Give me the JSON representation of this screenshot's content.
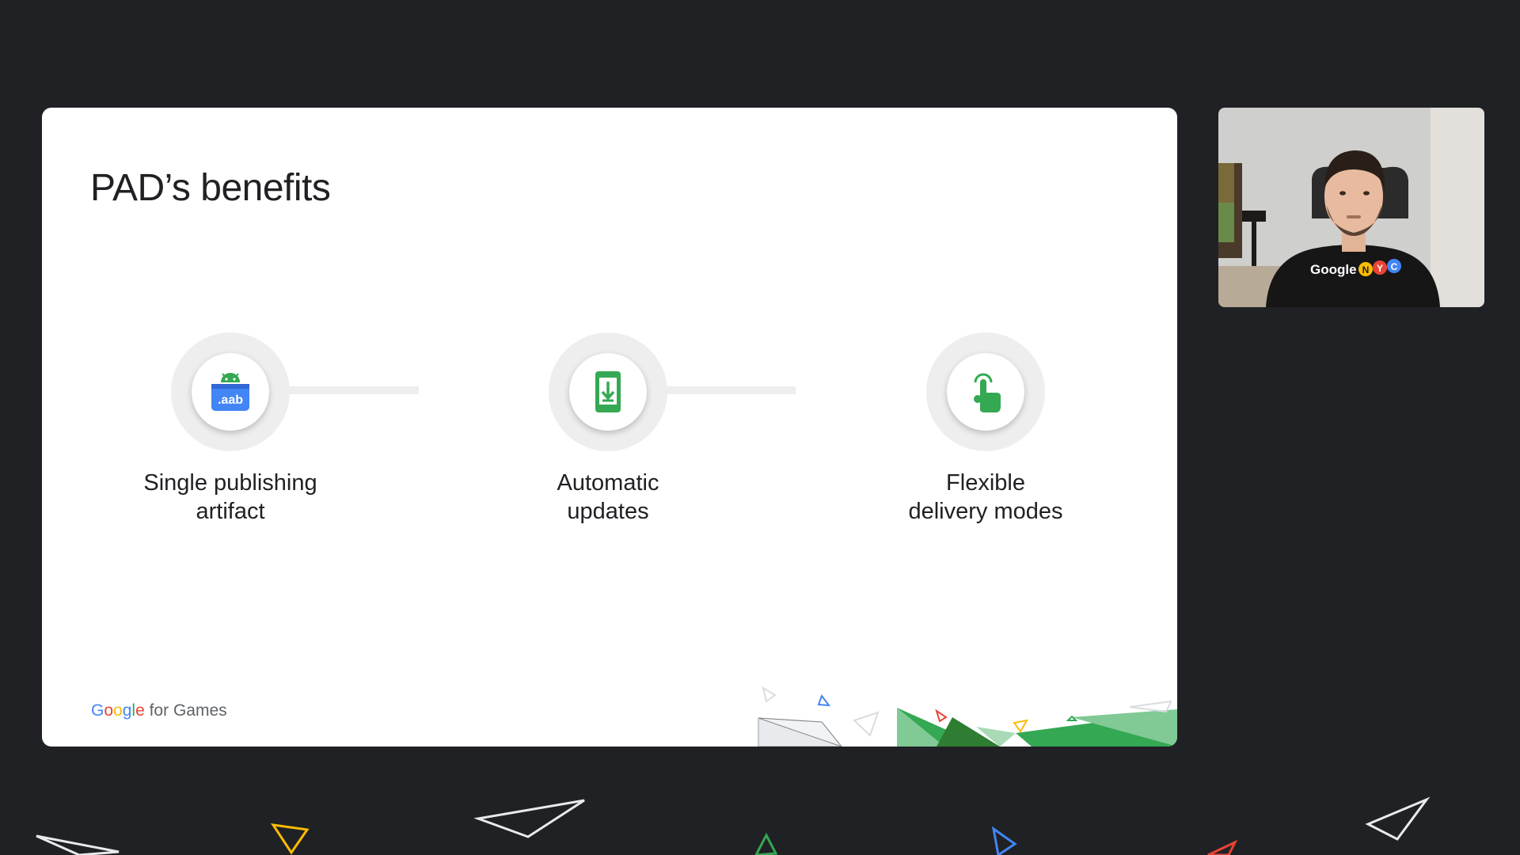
{
  "slide": {
    "title": "PAD’s benefits",
    "benefits": [
      {
        "label": "Single publishing\nartifact",
        "icon": "aab-package-icon",
        "icon_text": ".aab"
      },
      {
        "label": "Automatic\nupdates",
        "icon": "phone-download-icon"
      },
      {
        "label": "Flexible\ndelivery modes",
        "icon": "tap-hand-icon"
      }
    ],
    "brand": {
      "google_letters": [
        "G",
        "o",
        "o",
        "g",
        "l",
        "e"
      ],
      "suffix": " for Games"
    }
  },
  "webcam": {
    "shirt_text": "Google",
    "shirt_badges": [
      "N",
      "Y",
      "C"
    ]
  },
  "colors": {
    "background": "#202124",
    "slide": "#ffffff",
    "android_green": "#34a853",
    "google_blue": "#4285f4",
    "google_red": "#ea4335",
    "google_yellow": "#fbbc04"
  }
}
